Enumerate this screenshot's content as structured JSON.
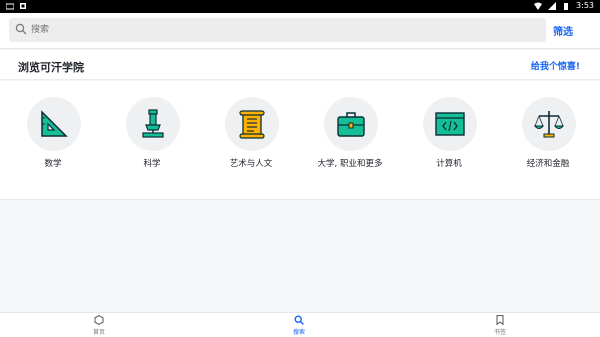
{
  "statusbar": {
    "time": "3:53"
  },
  "search": {
    "placeholder": "搜索",
    "filter_label": "筛选"
  },
  "header": {
    "title": "浏览可汗学院",
    "link": "给我个惊喜!"
  },
  "categories": [
    {
      "label": "数学",
      "icon": "ruler-triangle-icon"
    },
    {
      "label": "科学",
      "icon": "microscope-icon"
    },
    {
      "label": "艺术与人文",
      "icon": "scroll-icon"
    },
    {
      "label": "大学, 职业和更多",
      "icon": "briefcase-icon"
    },
    {
      "label": "计算机",
      "icon": "code-window-icon"
    },
    {
      "label": "经济和金融",
      "icon": "scales-icon"
    }
  ],
  "bottom_nav": [
    {
      "label": "首页",
      "icon": "hexagon-home-icon"
    },
    {
      "label": "搜索",
      "icon": "search-icon"
    },
    {
      "label": "书签",
      "icon": "bookmark-icon"
    }
  ],
  "colors": {
    "accent": "#1865f2",
    "teal": "#14bf96",
    "yellow": "#ffb100"
  }
}
